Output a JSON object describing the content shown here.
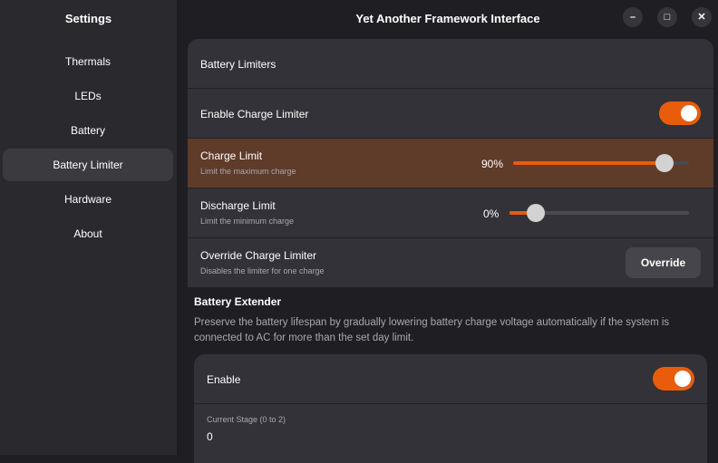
{
  "sidebar": {
    "title": "Settings",
    "items": [
      {
        "label": "Thermals"
      },
      {
        "label": "LEDs"
      },
      {
        "label": "Battery"
      },
      {
        "label": "Battery Limiter",
        "active": true
      },
      {
        "label": "Hardware"
      },
      {
        "label": "About"
      }
    ]
  },
  "header": {
    "title": "Yet Another Framework Interface",
    "minimize": "–",
    "maximize": "□",
    "close": "✕"
  },
  "limiters": {
    "title": "Battery Limiters",
    "enable_label": "Enable Charge Limiter",
    "enable_on": true,
    "charge": {
      "label": "Charge Limit",
      "sub": "Limit the maximum charge",
      "value_text": "90%",
      "value": 90
    },
    "discharge": {
      "label": "Discharge Limit",
      "sub": "Limit the minimum charge",
      "value_text": "0%",
      "value": 0
    },
    "override": {
      "label": "Override Charge Limiter",
      "sub": "Disables the limiter for one charge",
      "button": "Override"
    }
  },
  "extender": {
    "title": "Battery Extender",
    "description": "Preserve the battery lifespan by gradually lowering battery charge voltage automatically if the system is connected to AC for more than the set day limit.",
    "enable_label": "Enable",
    "enable_on": true,
    "stage_label": "Current Stage (0 to 2)",
    "stage_value": "0"
  },
  "colors": {
    "accent": "#e95c0b",
    "highlight": "#5f3b29"
  }
}
